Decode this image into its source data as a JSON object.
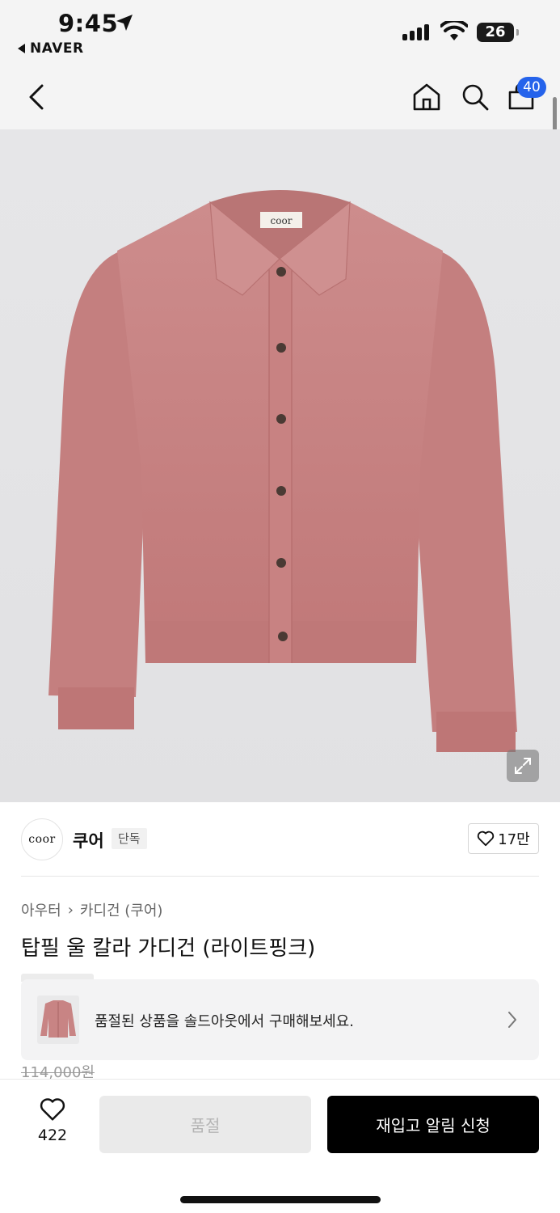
{
  "status_bar": {
    "time": "9:45",
    "back_app": "NAVER",
    "battery": "26"
  },
  "nav": {
    "cart_count": "40"
  },
  "product_image": {
    "label_text": "coor",
    "sweater_color": "#c98585"
  },
  "brand": {
    "logo_text": "coor",
    "name": "쿠어",
    "tag": "단독",
    "likes": "17만"
  },
  "breadcrumb": {
    "category": "아우터",
    "subcategory": "카디건 (쿠어)"
  },
  "product": {
    "title": "탑필 울 칼라 가디건 (라이트핑크)",
    "original_price": "114,000원"
  },
  "promo": {
    "text": "품절된 상품을 솔드아웃에서 구매해보세요."
  },
  "bottom_bar": {
    "wish_count": "422",
    "soldout_label": "품절",
    "restock_label": "재입고 알림 신청"
  },
  "colors": {
    "badge_blue": "#2563eb",
    "primary_black": "#000000"
  }
}
